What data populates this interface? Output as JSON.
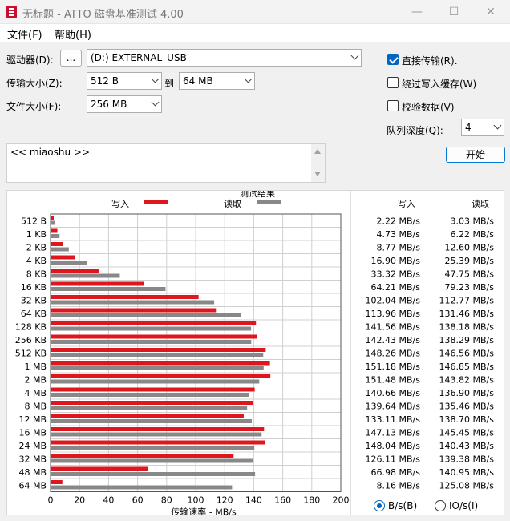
{
  "window": {
    "title": "无标题 - ATTO 磁盘基准测试 4.00",
    "minimize_glyph": "—",
    "maximize_glyph": "☐",
    "close_glyph": "✕"
  },
  "menu": {
    "file": "文件(F)",
    "help": "帮助(H)"
  },
  "controls": {
    "drive_label": "驱动器(D):",
    "browse_label": "...",
    "drive_value": "(D:) EXTERNAL_USB",
    "transfer_label": "传输大小(Z):",
    "transfer_from": "512 B",
    "to_label": "到",
    "transfer_to": "64 MB",
    "filesize_label": "文件大小(F):",
    "filesize_value": "256 MB",
    "direct_io_label": "直接传输(R).",
    "direct_io_checked": true,
    "bypass_cache_label": "绕过写入缓存(W)",
    "bypass_cache_checked": false,
    "verify_label": "校验数据(V)",
    "verify_checked": false,
    "queue_label": "队列深度(Q):",
    "queue_value": "4",
    "start_label": "开始",
    "description": "<< miaoshu >>"
  },
  "chart_data": {
    "type": "bar",
    "orientation": "horizontal",
    "title": "测试结果",
    "xlabel": "传输速率 - MB/s",
    "xlim": [
      0,
      200
    ],
    "xticks": [
      0,
      20,
      40,
      60,
      80,
      100,
      120,
      140,
      160,
      180,
      200
    ],
    "grid": true,
    "legend_position": "top",
    "categories": [
      "512 B",
      "1 KB",
      "2 KB",
      "4 KB",
      "8 KB",
      "16 KB",
      "32 KB",
      "64 KB",
      "128 KB",
      "256 KB",
      "512 KB",
      "1 MB",
      "2 MB",
      "4 MB",
      "8 MB",
      "12 MB",
      "16 MB",
      "24 MB",
      "32 MB",
      "48 MB",
      "64 MB"
    ],
    "series": [
      {
        "name": "写入",
        "color": "#e0161e",
        "values": [
          2.22,
          4.73,
          8.77,
          16.9,
          33.32,
          64.21,
          102.04,
          113.96,
          141.56,
          142.43,
          148.26,
          151.18,
          151.48,
          140.66,
          139.64,
          133.11,
          147.13,
          148.04,
          126.11,
          66.98,
          8.16
        ],
        "labels": [
          "2.22 MB/s",
          "4.73 MB/s",
          "8.77 MB/s",
          "16.90 MB/s",
          "33.32 MB/s",
          "64.21 MB/s",
          "102.04 MB/s",
          "113.96 MB/s",
          "141.56 MB/s",
          "142.43 MB/s",
          "148.26 MB/s",
          "151.18 MB/s",
          "151.48 MB/s",
          "140.66 MB/s",
          "139.64 MB/s",
          "133.11 MB/s",
          "147.13 MB/s",
          "148.04 MB/s",
          "126.11 MB/s",
          "66.98 MB/s",
          "8.16 MB/s"
        ]
      },
      {
        "name": "读取",
        "color": "#888888",
        "values": [
          3.03,
          6.22,
          12.6,
          25.39,
          47.75,
          79.23,
          112.77,
          131.46,
          138.18,
          138.29,
          146.56,
          146.85,
          143.82,
          136.9,
          135.46,
          138.7,
          145.45,
          140.43,
          139.38,
          140.95,
          125.08
        ],
        "labels": [
          "3.03 MB/s",
          "6.22 MB/s",
          "12.60 MB/s",
          "25.39 MB/s",
          "47.75 MB/s",
          "79.23 MB/s",
          "112.77 MB/s",
          "131.46 MB/s",
          "138.18 MB/s",
          "138.29 MB/s",
          "146.56 MB/s",
          "146.85 MB/s",
          "143.82 MB/s",
          "136.90 MB/s",
          "135.46 MB/s",
          "138.70 MB/s",
          "145.45 MB/s",
          "140.43 MB/s",
          "139.38 MB/s",
          "140.95 MB/s",
          "125.08 MB/s"
        ]
      }
    ]
  },
  "results": {
    "write_header": "写入",
    "read_header": "读取",
    "unit_bs_label": "B/s(B)",
    "unit_ios_label": "IO/s(I)",
    "unit_selected": "B/s"
  }
}
